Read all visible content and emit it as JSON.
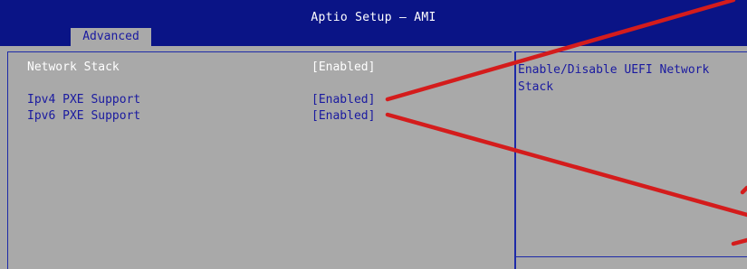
{
  "app": {
    "title": "Aptio Setup – AMI"
  },
  "tabs": [
    {
      "label": "Advanced",
      "selected": true
    }
  ],
  "settings": [
    {
      "label": "Network Stack",
      "value": "[Enabled]",
      "active": true
    },
    {
      "label": "Ipv4 PXE Support",
      "value": "[Enabled]",
      "active": false
    },
    {
      "label": "Ipv6 PXE Support",
      "value": "[Enabled]",
      "active": false
    }
  ],
  "help": {
    "text": "Enable/Disable UEFI Network Stack"
  },
  "colors": {
    "header_bg": "#0a1486",
    "panel_bg": "#a9a9a9",
    "text_blue": "#1a1aa0",
    "text_active": "#ffffff",
    "annotation_red": "#d41c1c"
  }
}
